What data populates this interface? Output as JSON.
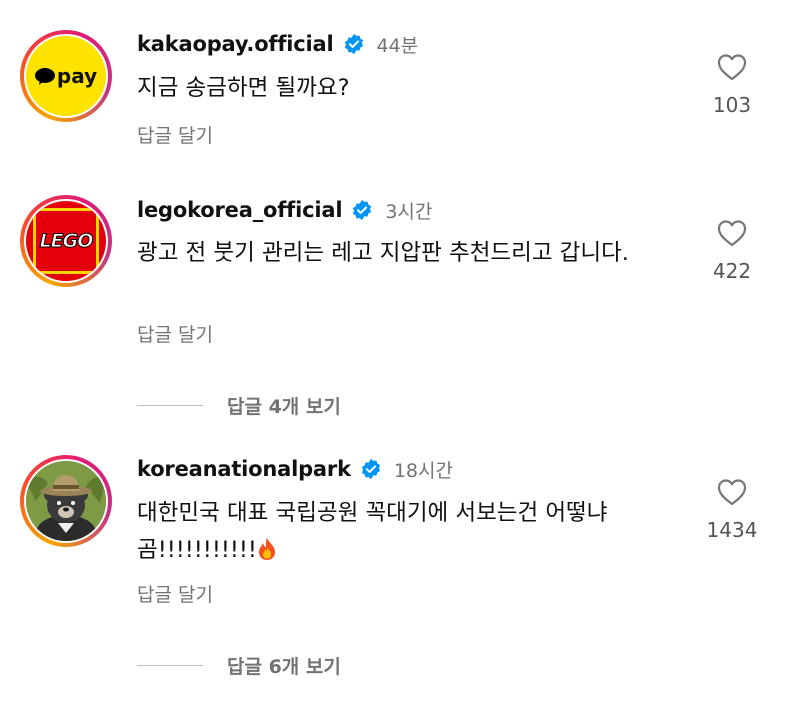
{
  "comments": [
    {
      "username": "kakaopay.official",
      "time": "44분",
      "text": "지금 송금하면 될까요?",
      "reply_label": "답글 달기",
      "likes": "103",
      "avatar": {
        "type": "kakaopay",
        "label": "pay",
        "bg": "#FFE300"
      }
    },
    {
      "username": "legokorea_official",
      "time": "3시간",
      "text": "광고 전 붓기 관리는 레고 지압판 추천드리고 갑니다.",
      "reply_label": "답글 달기",
      "likes": "422",
      "view_replies": "답글 4개 보기",
      "avatar": {
        "type": "lego",
        "label": "LEGO",
        "bg": "#E3000B"
      }
    },
    {
      "username": "koreanationalpark",
      "time": "18시간",
      "text": "대한민국 대표 국립공원 꼭대기에 서보는건 어떻냐곰!!!!!!!!!!!",
      "emoji": "fire-emoji",
      "reply_label": "답글 달기",
      "likes": "1434",
      "view_replies": "답글 6개 보기",
      "avatar": {
        "type": "bear-ranger",
        "bg": "#6E8A3A"
      }
    }
  ],
  "colors": {
    "verified": "#0095F6",
    "muted": "#737373"
  }
}
